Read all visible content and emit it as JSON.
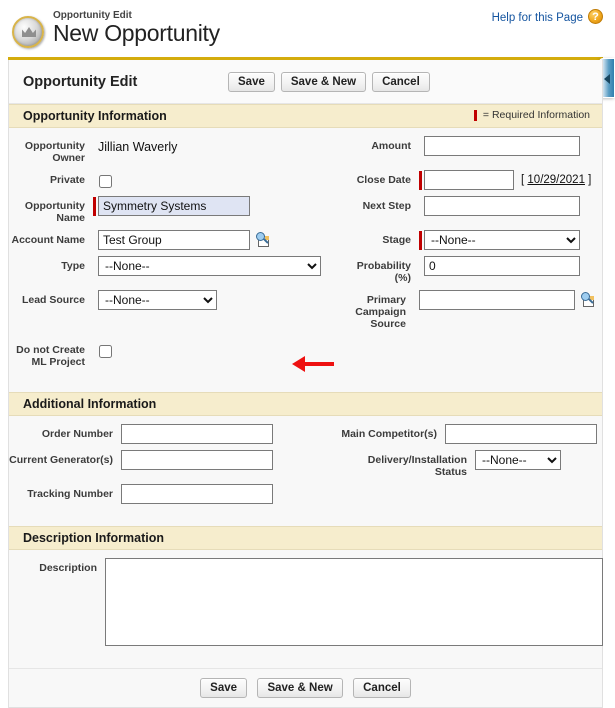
{
  "header": {
    "eyebrow": "Opportunity Edit",
    "title": "New Opportunity",
    "help_link": "Help for this Page",
    "help_icon": "question-mark-icon",
    "record_icon": "opportunity-coin-icon",
    "sidebar_toggle_icon": "collapse-left-icon"
  },
  "toolbar": {
    "title": "Opportunity Edit",
    "save_label": "Save",
    "save_new_label": "Save & New",
    "cancel_label": "Cancel"
  },
  "sections": {
    "opportunity_information": {
      "title": "Opportunity Information",
      "required_legend": "= Required Information"
    },
    "additional_information": {
      "title": "Additional Information"
    },
    "description_information": {
      "title": "Description Information"
    }
  },
  "fields": {
    "opportunity_owner": {
      "label": "Opportunity Owner",
      "value": "Jillian Waverly"
    },
    "amount": {
      "label": "Amount",
      "value": ""
    },
    "private": {
      "label": "Private",
      "checked": false
    },
    "close_date": {
      "label": "Close Date",
      "value": "",
      "today_link": "10/29/2021",
      "bracket_open": "[",
      "bracket_close": "]"
    },
    "opportunity_name": {
      "label": "Opportunity Name",
      "value": "Symmetry Systems"
    },
    "next_step": {
      "label": "Next Step",
      "value": ""
    },
    "account_name": {
      "label": "Account Name",
      "value": "Test Group",
      "lookup_icon": "lookup-search-icon"
    },
    "stage": {
      "label": "Stage",
      "value": "--None--",
      "options": [
        "--None--"
      ]
    },
    "type": {
      "label": "Type",
      "value": "--None--",
      "options": [
        "--None--"
      ]
    },
    "probability": {
      "label": "Probability (%)",
      "value": "0"
    },
    "lead_source": {
      "label": "Lead Source",
      "value": "--None--",
      "options": [
        "--None--"
      ]
    },
    "primary_campaign_source": {
      "label": "Primary Campaign Source",
      "value": "",
      "lookup_icon": "lookup-search-icon"
    },
    "do_not_create_ml_project": {
      "label": "Do not Create ML Project",
      "checked": false
    },
    "order_number": {
      "label": "Order Number",
      "value": ""
    },
    "main_competitors": {
      "label": "Main Competitor(s)",
      "value": ""
    },
    "current_generators": {
      "label": "Current Generator(s)",
      "value": ""
    },
    "delivery_installation_status": {
      "label": "Delivery/Installation Status",
      "value": "--None--",
      "options": [
        "--None--"
      ]
    },
    "tracking_number": {
      "label": "Tracking Number",
      "value": ""
    },
    "description": {
      "label": "Description",
      "value": ""
    }
  },
  "footer": {
    "save_label": "Save",
    "save_new_label": "Save & New",
    "cancel_label": "Cancel"
  },
  "annotation": {
    "arrow_icon": "red-left-arrow-annotation",
    "color": "#ee1111"
  },
  "colors": {
    "section_band": "#f6edcd",
    "gold_rule": "#d4ac0d",
    "required_mark": "#c00000",
    "link": "#1555a0",
    "highlight_field": "#dfe4f3"
  }
}
